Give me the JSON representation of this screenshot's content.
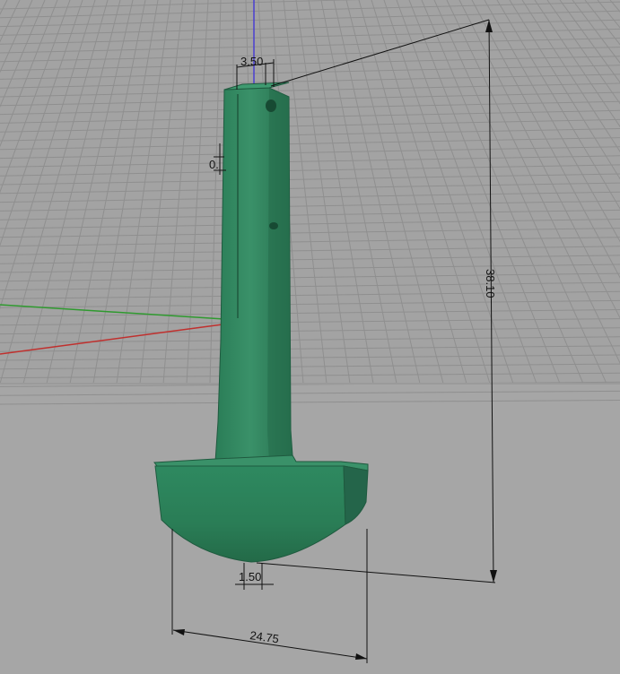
{
  "viewport": {
    "background_color": "#a6a6a6",
    "grid_color": "#8e8e8e",
    "axis_colors": {
      "x": "#c0302e",
      "y": "#2f9a2f",
      "z": "#4a3fd0"
    },
    "model_color": "#2e7d5b"
  },
  "dimensions": {
    "top_width": "3.50",
    "side_offset": "0.",
    "height": "38.10",
    "base_gap": "1.50",
    "base_width": "24.75"
  }
}
